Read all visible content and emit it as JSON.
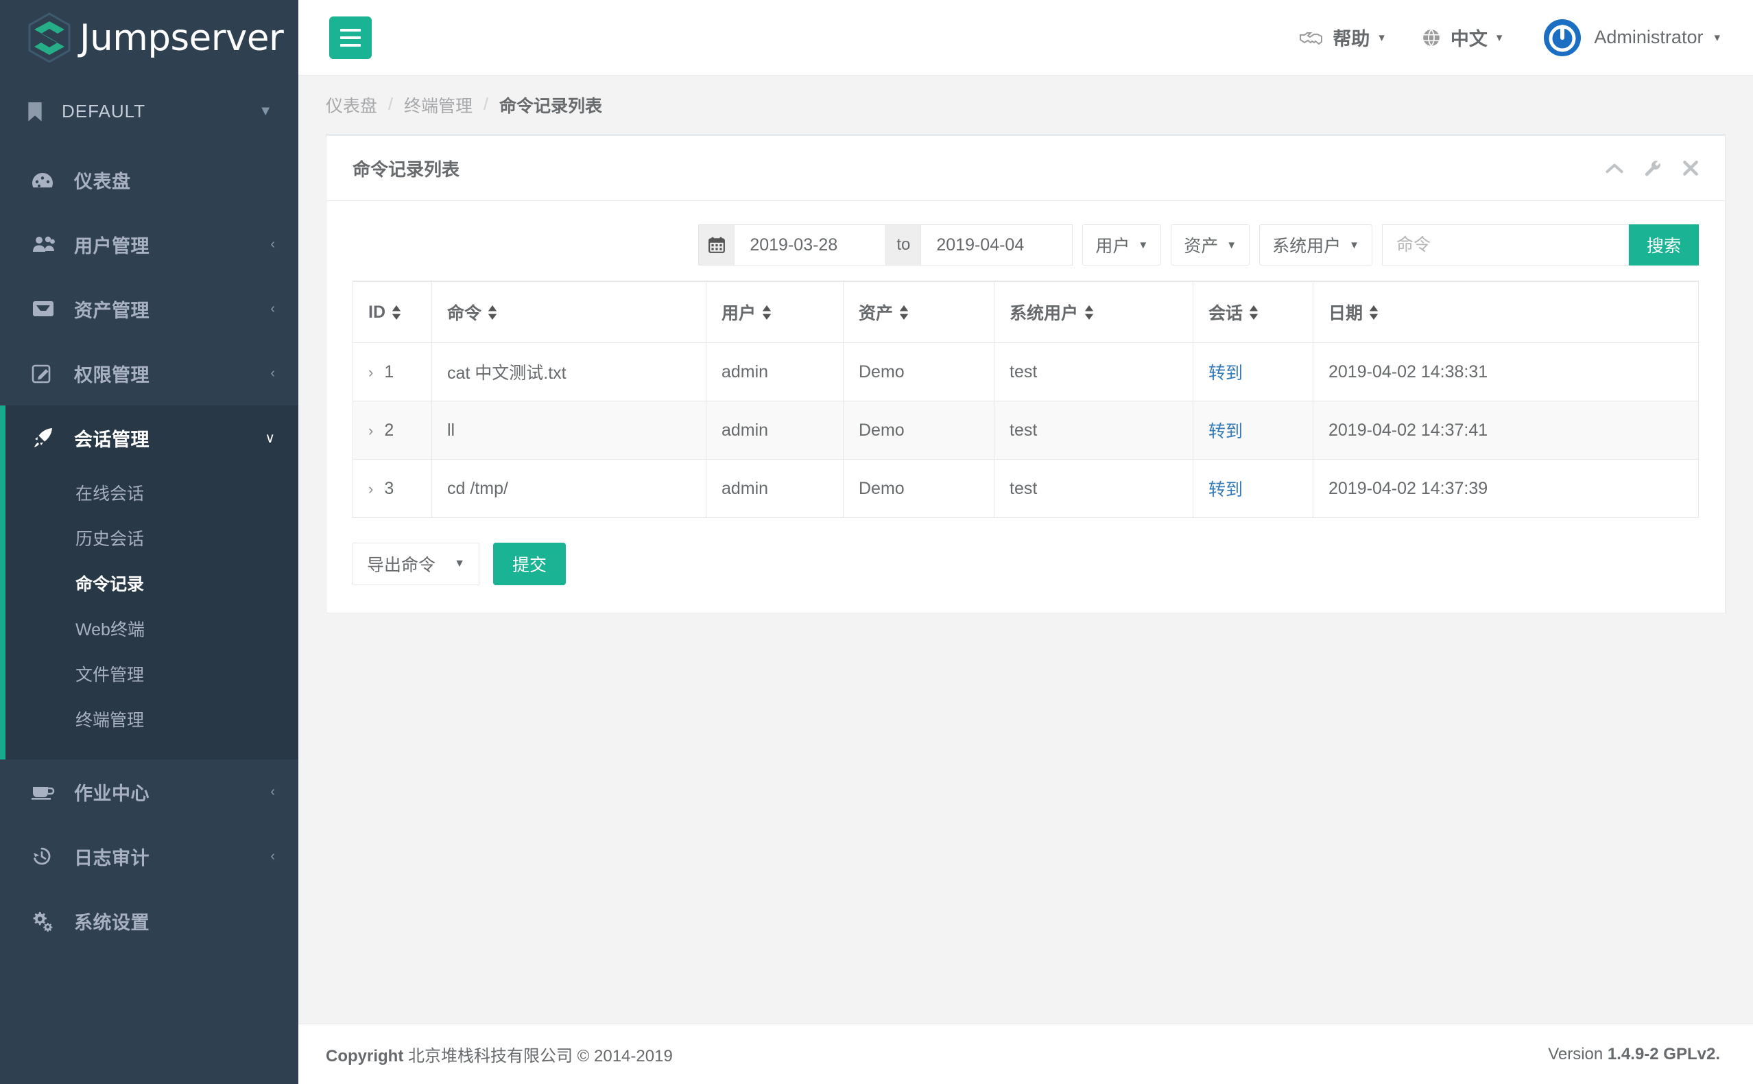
{
  "brand": {
    "name": "Jumpserver",
    "logo_icon": "jumpserver-hex-logo"
  },
  "org": {
    "label": "DEFAULT",
    "icon": "bookmark-icon",
    "caret": "▼"
  },
  "sidebar": {
    "items": [
      {
        "label": "仪表盘",
        "icon": "dashboard-icon",
        "caret": "",
        "active": false
      },
      {
        "label": "用户管理",
        "icon": "users-icon",
        "caret": "‹",
        "active": false
      },
      {
        "label": "资产管理",
        "icon": "inbox-icon",
        "caret": "‹",
        "active": false
      },
      {
        "label": "权限管理",
        "icon": "edit-square-icon",
        "caret": "‹",
        "active": false
      },
      {
        "label": "会话管理",
        "icon": "rocket-icon",
        "caret": "∨",
        "active": true
      },
      {
        "label": "作业中心",
        "icon": "coffee-icon",
        "caret": "‹",
        "active": false
      },
      {
        "label": "日志审计",
        "icon": "history-icon",
        "caret": "‹",
        "active": false
      },
      {
        "label": "系统设置",
        "icon": "gears-icon",
        "caret": "",
        "active": false
      }
    ],
    "submenu": [
      {
        "label": "在线会话",
        "active": false
      },
      {
        "label": "历史会话",
        "active": false
      },
      {
        "label": "命令记录",
        "active": true
      },
      {
        "label": "Web终端",
        "active": false
      },
      {
        "label": "文件管理",
        "active": false
      },
      {
        "label": "终端管理",
        "active": false
      }
    ]
  },
  "topbar": {
    "menu_toggle_icon": "hamburger-icon",
    "help": {
      "label": "帮助",
      "icon": "handshake-icon",
      "caret": "▾"
    },
    "language": {
      "label": "中文",
      "icon": "globe-icon",
      "caret": "▾"
    },
    "user": {
      "name": "Administrator",
      "avatar_icon": "power-avatar-icon",
      "caret": "▾"
    }
  },
  "breadcrumb": {
    "items": [
      "仪表盘",
      "终端管理",
      "命令记录列表"
    ],
    "separator": "/"
  },
  "panel": {
    "title": "命令记录列表",
    "tools": [
      {
        "icon": "chevron-up-icon"
      },
      {
        "icon": "wrench-icon"
      },
      {
        "icon": "close-icon"
      }
    ]
  },
  "filters": {
    "calendar_icon": "calendar-icon",
    "date_from": "2019-03-28",
    "date_to_label": "to",
    "date_to": "2019-04-04",
    "dropdowns": [
      {
        "label": "用户",
        "caret": "▼"
      },
      {
        "label": "资产",
        "caret": "▼"
      },
      {
        "label": "系统用户",
        "caret": "▼"
      }
    ],
    "command_placeholder": "命令",
    "command_value": "",
    "search_label": "搜索"
  },
  "table": {
    "columns": [
      {
        "label": "ID",
        "sortable": true
      },
      {
        "label": "命令",
        "sortable": true
      },
      {
        "label": "用户",
        "sortable": true
      },
      {
        "label": "资产",
        "sortable": true
      },
      {
        "label": "系统用户",
        "sortable": true
      },
      {
        "label": "会话",
        "sortable": true
      },
      {
        "label": "日期",
        "sortable": true
      }
    ],
    "expand_glyph": "›",
    "rows": [
      {
        "id": "1",
        "command": "cat 中文测试.txt",
        "user": "admin",
        "asset": "Demo",
        "system_user": "test",
        "session": "转到",
        "date": "2019-04-02 14:38:31"
      },
      {
        "id": "2",
        "command": "ll",
        "user": "admin",
        "asset": "Demo",
        "system_user": "test",
        "session": "转到",
        "date": "2019-04-02 14:37:41"
      },
      {
        "id": "3",
        "command": "cd /tmp/",
        "user": "admin",
        "asset": "Demo",
        "system_user": "test",
        "session": "转到",
        "date": "2019-04-02 14:37:39"
      }
    ]
  },
  "actions": {
    "select_label": "导出命令",
    "select_caret": "▼",
    "submit_label": "提交"
  },
  "footer": {
    "copyright_strong": "Copyright",
    "copyright_rest": " 北京堆栈科技有限公司 © 2014-2019",
    "version_label": "Version ",
    "version_value": "1.4.9-2 GPLv2."
  },
  "colors": {
    "sidebar_bg": "#2f4050",
    "sidebar_active_bg": "#293846",
    "accent_green": "#1ab394",
    "accent_green_dark": "#19aa8d",
    "link_blue": "#337ab7",
    "avatar_blue": "#1b6ec2",
    "text": "#676a6c"
  }
}
